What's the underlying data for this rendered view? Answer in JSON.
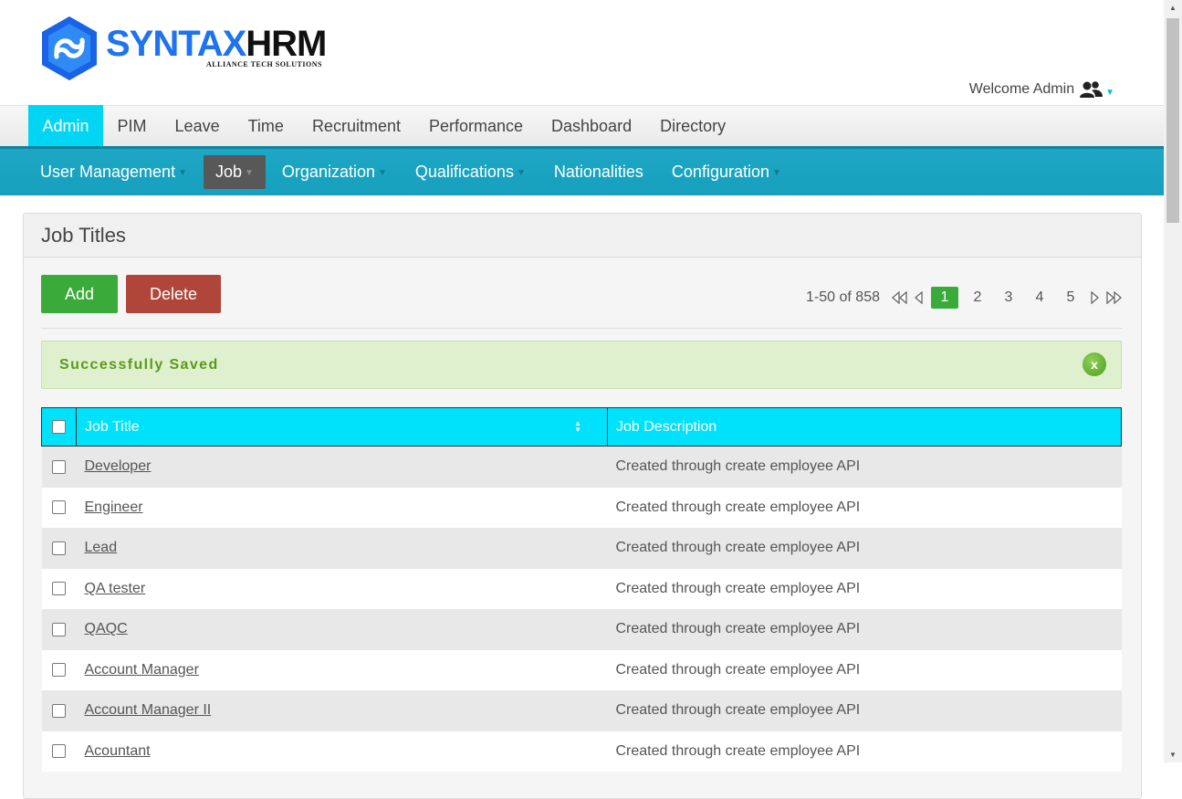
{
  "logo": {
    "brand_part1": "SYNTAX",
    "brand_part2": "HRM",
    "tagline": "ALLIANCE TECH SOLUTIONS"
  },
  "header": {
    "welcome": "Welcome Admin",
    "user_icon": "users-icon"
  },
  "main_menu": [
    "Admin",
    "PIM",
    "Leave",
    "Time",
    "Recruitment",
    "Performance",
    "Dashboard",
    "Directory"
  ],
  "sub_menu": {
    "user_management": "User Management",
    "job": "Job",
    "organization": "Organization",
    "qualifications": "Qualifications",
    "nationalities": "Nationalities",
    "configuration": "Configuration"
  },
  "panel": {
    "title": "Job Titles"
  },
  "buttons": {
    "add": "Add",
    "delete": "Delete"
  },
  "pagination": {
    "summary": "1-50 of 858",
    "pages": [
      "1",
      "2",
      "3",
      "4",
      "5"
    ],
    "current": "1"
  },
  "alert": {
    "message": "Successfully Saved",
    "close": "x"
  },
  "table": {
    "headers": {
      "title": "Job Title",
      "description": "Job Description"
    },
    "rows": [
      {
        "title": "Developer",
        "description": "Created through create employee API"
      },
      {
        "title": "Engineer",
        "description": "Created through create employee API"
      },
      {
        "title": "Lead",
        "description": "Created through create employee API"
      },
      {
        "title": "QA tester",
        "description": "Created through create employee API"
      },
      {
        "title": "QAQC",
        "description": "Created through create employee API"
      },
      {
        "title": "Account Manager",
        "description": "Created through create employee API"
      },
      {
        "title": "Account Manager II",
        "description": "Created through create employee API"
      },
      {
        "title": "Acountant",
        "description": "Created through create employee API"
      }
    ]
  },
  "colors": {
    "accent": "#00e1fb",
    "submenu": "#1da7c4",
    "add": "#3aaa3a",
    "delete": "#b0463a",
    "success_bg": "#dff0cf"
  }
}
